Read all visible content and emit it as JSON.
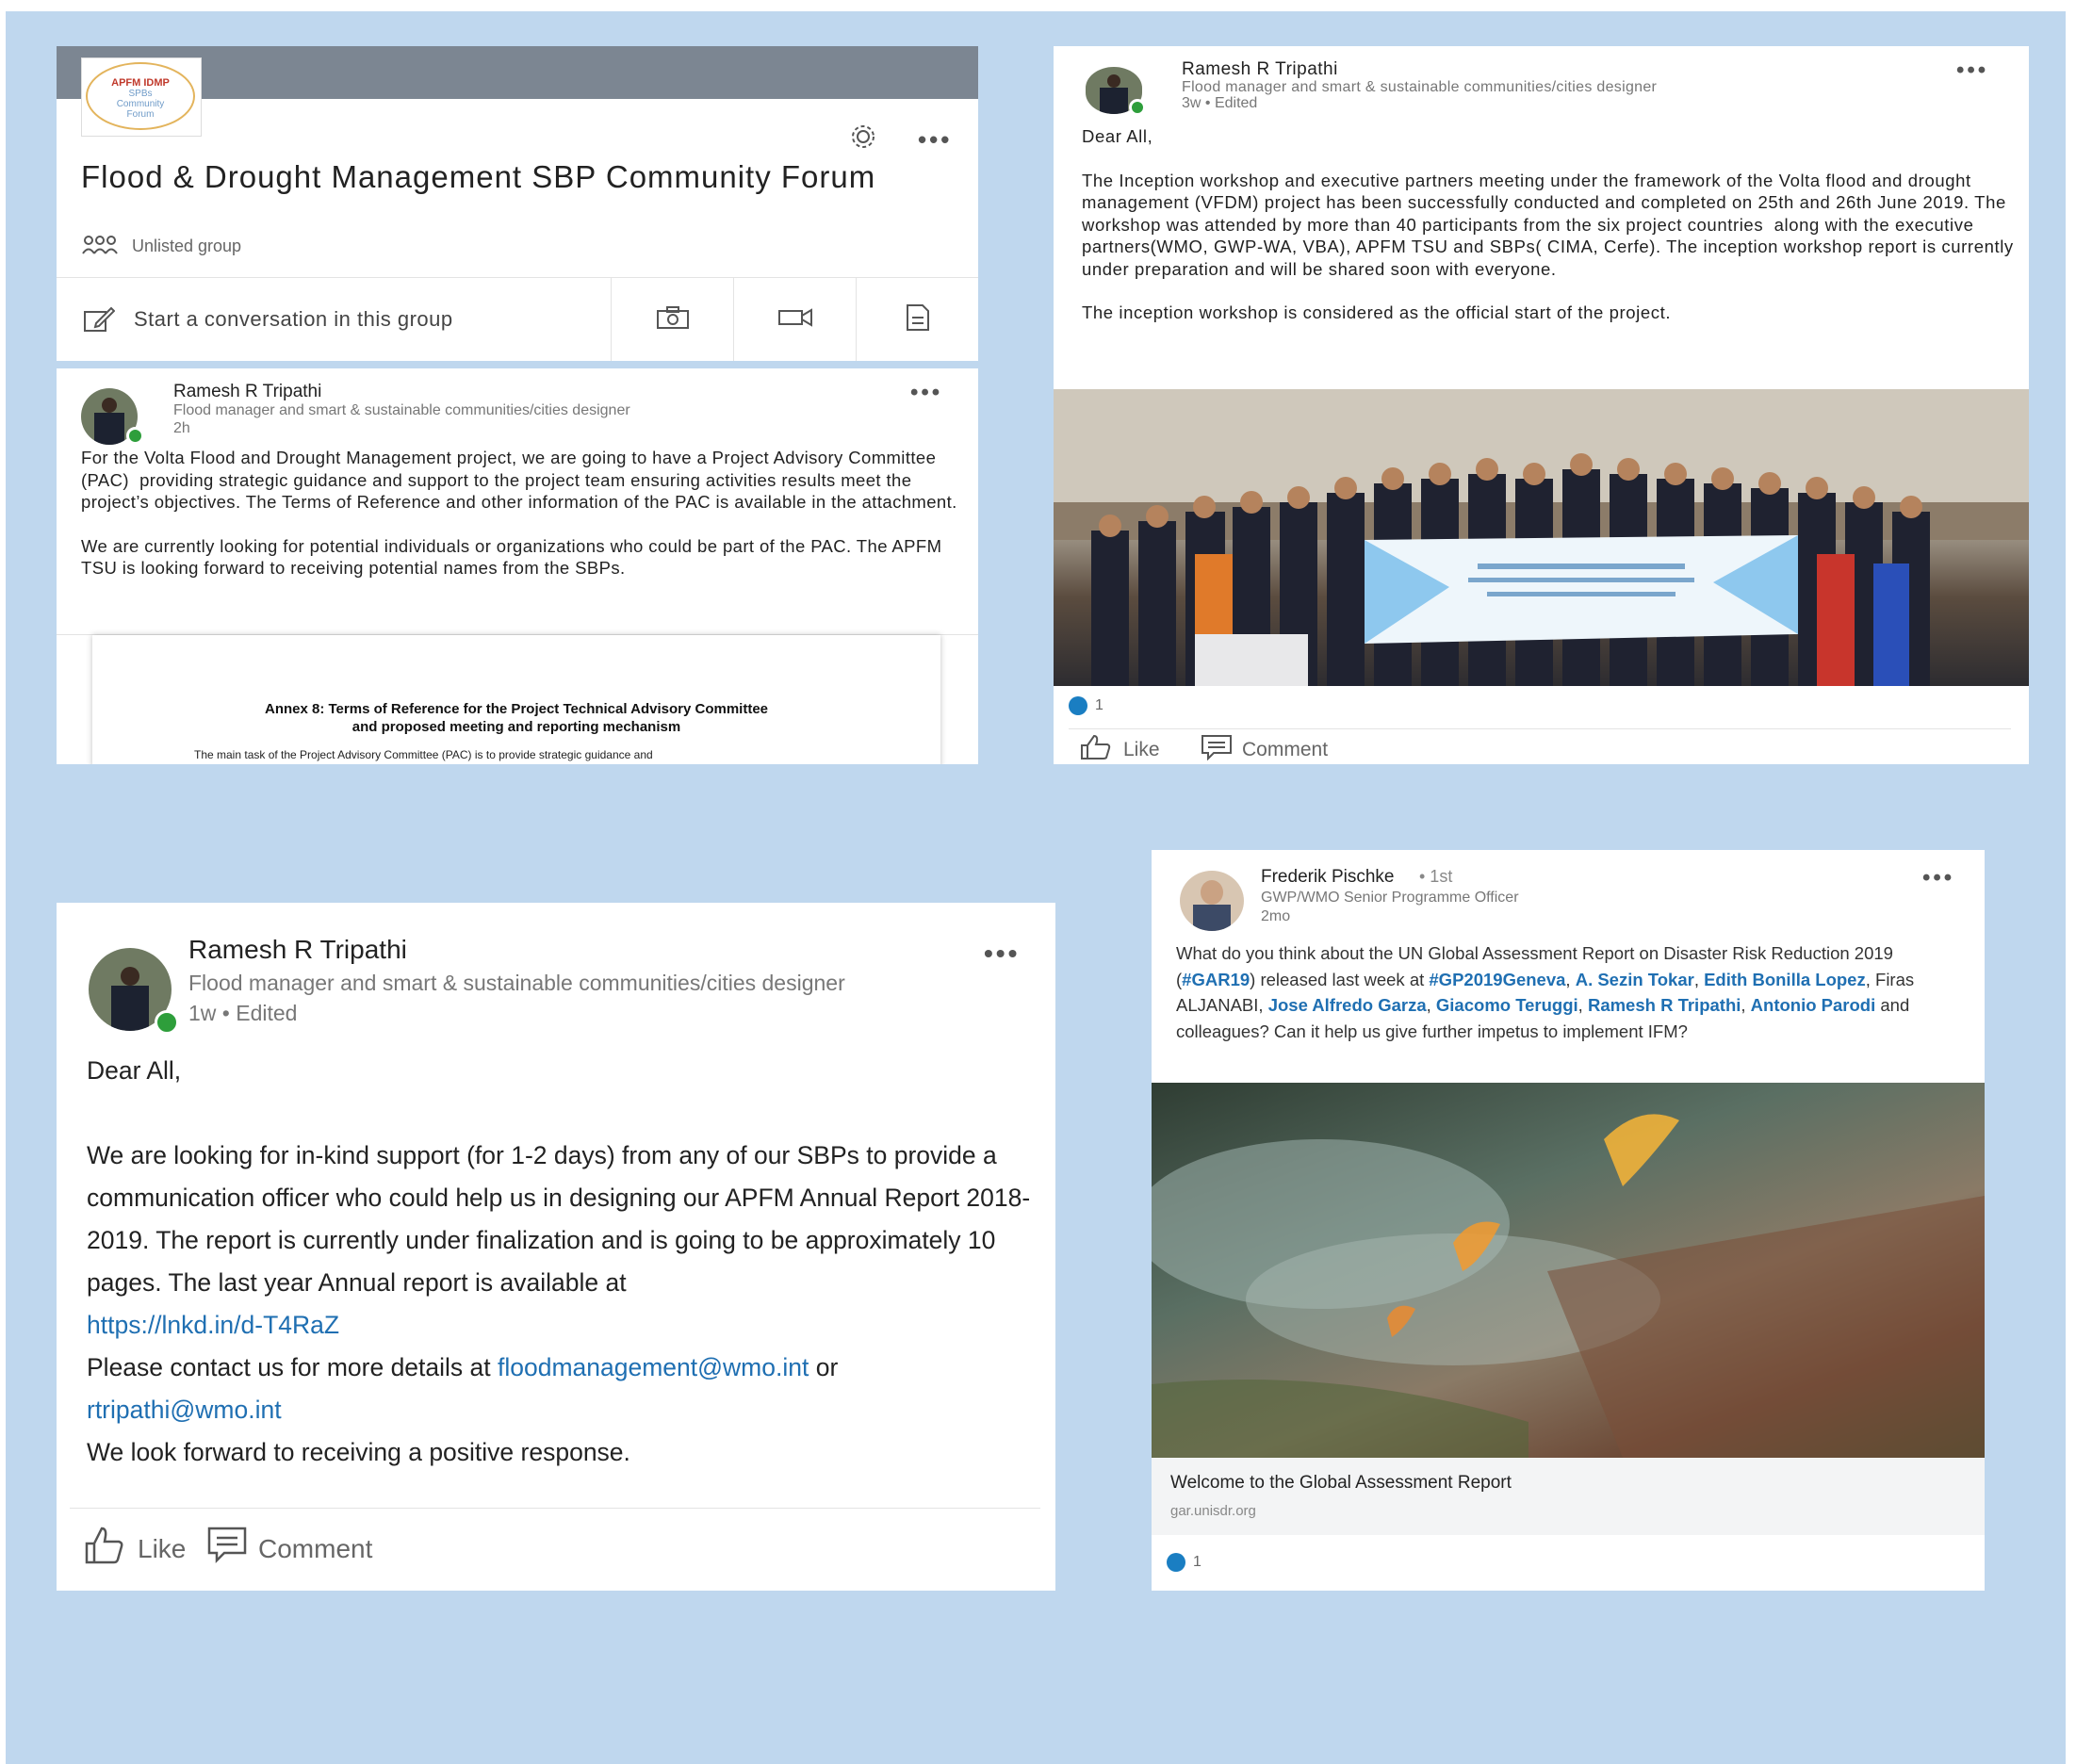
{
  "group_card": {
    "logo_lines": [
      "APFM IDMP",
      "SPBs",
      "Community",
      "Forum"
    ],
    "title": "Flood & Drought Management SBP Community Forum",
    "group_type": "Unlisted group",
    "start_conversation": "Start a conversation in this group",
    "icons": [
      "gear-icon",
      "more-icon",
      "pencil-icon",
      "camera-icon",
      "video-icon",
      "document-icon",
      "group-icon"
    ]
  },
  "post1": {
    "author": "Ramesh R Tripathi",
    "headline": "Flood manager and smart & sustainable communities/cities designer",
    "time": "2h",
    "para1": "For the Volta Flood and Drought Management project, we are going to have a Project Advisory Committee (PAC)  providing strategic guidance and support to the project team ensuring activities results meet the project’s objectives. The Terms of Reference and other information of the PAC is available in the attachment.",
    "para2": "We are currently looking for potential individuals or organizations who could be part of the PAC. The APFM TSU is looking forward to receiving potential names from the SBPs.",
    "doc_heading_1": "Annex 8:  Terms of Reference for the Project Technical Advisory Committee",
    "doc_heading_2": "and proposed meeting and reporting mechanism",
    "doc_text": "The main task of the Project Advisory Committee (PAC) is to provide strategic guidance and"
  },
  "post2": {
    "author": "Ramesh R Tripathi",
    "headline": "Flood manager and smart & sustainable communities/cities designer",
    "time": "3w • Edited",
    "greeting": "Dear All,",
    "para1": "The Inception workshop and executive partners meeting under the framework of the Volta flood and drought management (VFDM) project has been successfully conducted and completed on 25th and 26th June 2019. The workshop was attended by more than 40 participants from the six project countries  along with the executive partners(WMO, GWP-WA, VBA), APFM TSU and SBPs( CIMA, Cerfe). The inception workshop report is currently under preparation and will be shared soon with everyone.",
    "para2": "The inception workshop is considered as the official start of the project.",
    "reaction_count": "1",
    "like_label": "Like",
    "comment_label": "Comment"
  },
  "post3": {
    "author": "Ramesh R Tripathi",
    "headline": "Flood manager and smart & sustainable communities/cities designer",
    "time": "1w • Edited",
    "greeting": "Dear All,",
    "body_a": "We are looking for in-kind support (for 1-2 days) from any of our SBPs to provide a communication officer who could help us in designing our APFM Annual Report 2018-2019. The report is currently under finalization and is going to be approximately 10 pages. The last year Annual report is available at",
    "link_report": "https://lnkd.in/d-T4RaZ",
    "contact_text": "Please contact us for more details at ",
    "email1": "floodmanagement@wmo.int",
    "or_text": " or",
    "email2": "rtripathi@wmo.int",
    "closing": "We look forward to receiving a positive response.",
    "like_label": "Like",
    "comment_label": "Comment"
  },
  "post4": {
    "author": "Frederik Pischke",
    "degree": "• 1st",
    "headline": "GWP/WMO Senior Programme Officer",
    "time": "2mo",
    "t1": "What do you think about the UN Global Assessment Report on Disaster Risk Reduction 2019 (",
    "tag1": "#GAR19",
    "t2": ") released last week at ",
    "tag2": "#GP2019Geneva",
    "t3": ", ",
    "m1": "A. Sezin Tokar",
    "t4": ", ",
    "m2": "Edith Bonilla Lopez",
    "t5": ", Firas ALJANABI, ",
    "m3": "Jose Alfredo Garza",
    "t6": ", ",
    "m4": "Giacomo Teruggi",
    "t7": ", ",
    "m5": "Ramesh R Tripathi",
    "t8": ", ",
    "m6": "Antonio Parodi",
    "t9": " and colleagues? Can it help us give further impetus to implement IFM?",
    "link_title": "Welcome to the Global Assessment Report",
    "link_domain": "gar.unisdr.org",
    "reaction_count": "1"
  },
  "colors": {
    "background": "#bfd7ee",
    "link": "#1f6fb2",
    "online": "#2e9e3b",
    "reaction": "#1a7ec2"
  }
}
